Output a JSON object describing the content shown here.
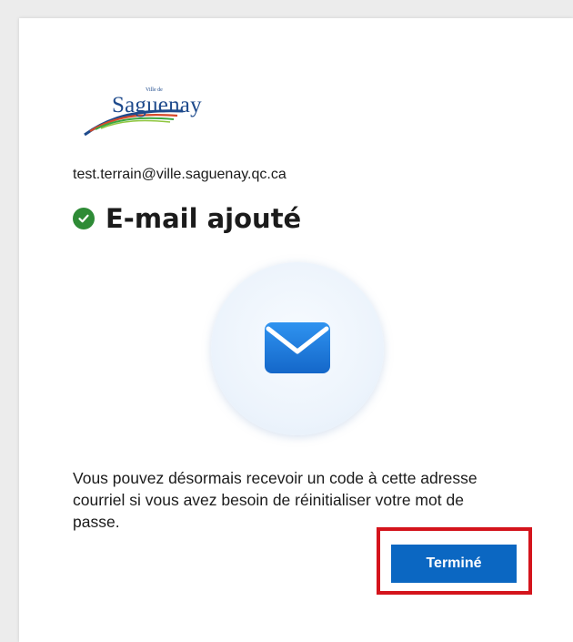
{
  "logo": {
    "small_text": "Ville de",
    "brand_text": "Saguenay",
    "swoosh_colors": [
      "#1e4a8c",
      "#d64a2a",
      "#3aa83f",
      "#8fc63f"
    ]
  },
  "account": {
    "email": "test.terrain@ville.saguenay.qc.ca"
  },
  "status": {
    "icon": "checkmark-circle-icon",
    "title": "E-mail ajouté",
    "color": "#2e8b36"
  },
  "illustration": {
    "icon": "envelope-icon",
    "color": "#1e7fe0"
  },
  "message": {
    "text": "Vous pouvez désormais recevoir un code à cette adresse courriel si vous avez besoin de réinitialiser votre mot de passe."
  },
  "actions": {
    "done_label": "Terminé",
    "button_color": "#0b67c2",
    "highlight_color": "#d4141c"
  }
}
